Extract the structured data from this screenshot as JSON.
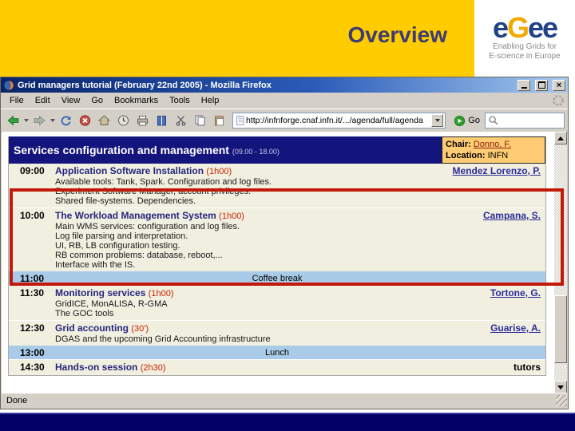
{
  "colors": {
    "brand-yellow": "#FFCC00",
    "title-blue": "#3C3C74",
    "egee-blue": "#1F4287",
    "egee-orange": "#F2A900",
    "footer-navy": "#000066",
    "agenda-navy": "#14147D",
    "chair-orange": "#FFCC73",
    "cream": "#F1EFDF",
    "band-blue": "#A9CBE8",
    "session-navy": "#26267E",
    "link-blue": "#2B2B9C",
    "dur-red": "#CC2200",
    "annotation-red": "#C21807"
  },
  "slide": {
    "title": "Overview",
    "logo": {
      "word_part1": "e",
      "word_accent": "G",
      "word_part2": "ee",
      "tagline_line1": "Enabling Grids for",
      "tagline_line2": "E-science in Europe"
    }
  },
  "browser": {
    "window_title": "Grid managers tutorial (February 22nd 2005) - Mozilla Firefox",
    "menus": [
      "File",
      "Edit",
      "View",
      "Go",
      "Bookmarks",
      "Tools",
      "Help"
    ],
    "toolbar_icons": [
      "back",
      "forward",
      "reload",
      "stop",
      "home",
      "history",
      "print",
      "bookmarks",
      "cut",
      "copy",
      "paste"
    ],
    "url": "http://infnforge.cnaf.infn.it/.../agenda/full/agenda",
    "go_label": "Go",
    "search_value": "",
    "status": "Done"
  },
  "agenda": {
    "header": {
      "title": "Services configuration and management",
      "time_range": "(09.00 - 18.00)",
      "chair_label": "Chair:",
      "chair_name": "Donno, F.",
      "location_label": "Location:",
      "location_name": "INFN"
    },
    "sessions": [
      {
        "type": "session",
        "time": "09:00",
        "title": "Application Software Installation",
        "duration": "(1h00)",
        "speaker": "Mendez Lorenzo, P.",
        "speaker_link": true,
        "details": [
          "Available tools: Tank, Spark. Configuration and log files.",
          "Experiment Software Manager, account privileges.",
          "Shared file-systems. Dependencies."
        ]
      },
      {
        "type": "session",
        "time": "10:00",
        "title": "The Workload Management System",
        "duration": "(1h00)",
        "speaker": "Campana, S.",
        "speaker_link": true,
        "details": [
          "Main WMS services: configuration and log files.",
          "Log file parsing and interpretation.",
          "UI, RB, LB configuration testing.",
          "RB common problems: database, reboot,...",
          "Interface with the IS."
        ]
      },
      {
        "type": "break",
        "time": "11:00",
        "title": "Coffee break"
      },
      {
        "type": "session",
        "time": "11:30",
        "title": "Monitoring services",
        "duration": "(1h00)",
        "speaker": "Tortone, G.",
        "speaker_link": true,
        "details": [
          "GridICE, MonALISA, R-GMA",
          "The GOC tools"
        ]
      },
      {
        "type": "session",
        "time": "12:30",
        "title": "Grid accounting",
        "duration": "(30')",
        "speaker": "Guarise, A.",
        "speaker_link": true,
        "details": [
          "DGAS and the upcoming Grid Accounting infrastructure"
        ]
      },
      {
        "type": "break",
        "time": "13:00",
        "title": "Lunch"
      },
      {
        "type": "session",
        "time": "14:30",
        "title": "Hands-on session",
        "duration": "(2h30)",
        "speaker": "tutors",
        "speaker_link": false,
        "details": []
      }
    ]
  }
}
